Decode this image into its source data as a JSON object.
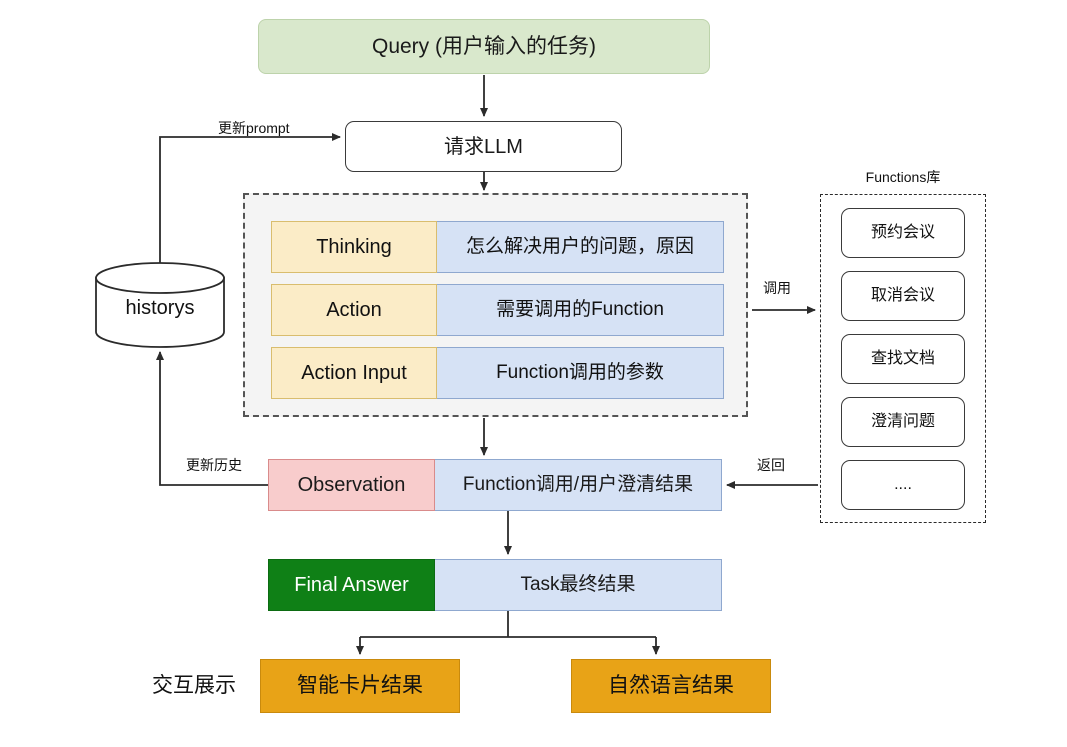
{
  "diagram": {
    "title_nodes": {
      "query": "Query (用户输入的任务)",
      "llm": "请求LLM",
      "history": "historys",
      "functions_title": "Functions库",
      "display_label": "交互展示"
    },
    "react_rows": [
      {
        "label": "Thinking",
        "value": "怎么解决用户的问题，原因"
      },
      {
        "label": "Action",
        "value": "需要调用的Function"
      },
      {
        "label": "Action Input",
        "value": "Function调用的参数"
      }
    ],
    "observation": {
      "label": "Observation",
      "value": "Function调用/用户澄清结果"
    },
    "final_answer": {
      "label": "Final Answer",
      "value": "Task最终结果"
    },
    "outputs": [
      {
        "label": "智能卡片结果"
      },
      {
        "label": "自然语言结果"
      }
    ],
    "functions": [
      {
        "label": "预约会议"
      },
      {
        "label": "取消会议"
      },
      {
        "label": "查找文档"
      },
      {
        "label": "澄清问题"
      },
      {
        "label": "...."
      }
    ],
    "edge_labels": {
      "update_prompt": "更新prompt",
      "update_history": "更新历史",
      "call": "调用",
      "return": "返回"
    },
    "colors": {
      "query_fill": "#d9e8cc",
      "react_label_fill": "#fbecc7",
      "react_value_fill": "#d6e2f5",
      "observation_fill": "#f8cccc",
      "final_answer_fill": "#0f8016",
      "output_fill": "#e8a317",
      "zone_fill": "#f4f4f4",
      "stroke": "#3a3a3a"
    }
  }
}
